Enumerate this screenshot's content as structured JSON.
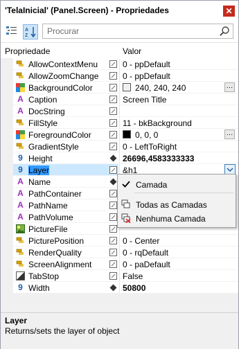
{
  "window": {
    "title": "'TelaInicial' (Panel.Screen) - Propriedades",
    "close_glyph": "✕"
  },
  "toolbar": {
    "search_placeholder": "Procurar"
  },
  "header": {
    "property_col": "Propriedade",
    "value_col": "Valor"
  },
  "rows": [
    {
      "name": "AllowContextMenu",
      "value": "0 - ppDefault",
      "icon": "enum-icon",
      "bold": false
    },
    {
      "name": "AllowZoomChange",
      "value": "0 - ppDefault",
      "icon": "enum-icon",
      "bold": false
    },
    {
      "name": "BackgroundColor",
      "value": "240, 240, 240",
      "icon": "color-icon",
      "swatch": "#f0f0f0",
      "ellipsis": "…"
    },
    {
      "name": "Caption",
      "value": "Screen Title",
      "icon": "text-icon"
    },
    {
      "name": "DocString",
      "value": "",
      "icon": "text-icon"
    },
    {
      "name": "FillStyle",
      "value": "11 - bkBackground",
      "icon": "enum-icon"
    },
    {
      "name": "ForegroundColor",
      "value": "0, 0, 0",
      "icon": "color-icon",
      "swatch": "#000000",
      "ellipsis": "…"
    },
    {
      "name": "GradientStyle",
      "value": "0 - LeftToRight",
      "icon": "enum-icon"
    },
    {
      "name": "Height",
      "value": "26696,4583333333",
      "icon": "number-icon",
      "bold": true,
      "mark": "diamond"
    },
    {
      "name": "Layer",
      "value": "&h1",
      "icon": "number-icon",
      "selected": true
    },
    {
      "name": "Name",
      "value": "",
      "icon": "text-icon",
      "mark": "diamond"
    },
    {
      "name": "PathContainer",
      "value": "",
      "icon": "text-icon"
    },
    {
      "name": "PathName",
      "value": "",
      "icon": "text-icon"
    },
    {
      "name": "PathVolume",
      "value": "",
      "icon": "text-icon"
    },
    {
      "name": "PictureFile",
      "value": "",
      "icon": "picture-icon"
    },
    {
      "name": "PicturePosition",
      "value": "0 - Center",
      "icon": "enum-icon"
    },
    {
      "name": "RenderQuality",
      "value": "0 - rqDefault",
      "icon": "enum-icon"
    },
    {
      "name": "ScreenAlignment",
      "value": "0 - paDefault",
      "icon": "enum-icon"
    },
    {
      "name": "TabStop",
      "value": "False",
      "icon": "bool-icon"
    },
    {
      "name": "Width",
      "value": "50800",
      "icon": "number-icon",
      "bold": true,
      "mark": "diamond"
    }
  ],
  "dropdown": {
    "items": [
      {
        "label": "Camada",
        "checked": true
      },
      {
        "label": "Todas as Camadas"
      },
      {
        "label": "Nenhuma Camada"
      }
    ]
  },
  "description": {
    "title": "Layer",
    "text": "Returns/sets the layer of object"
  },
  "colors": {
    "selection": "#cce8ff",
    "accent": "#3399ff",
    "close": "#c42b1c"
  }
}
